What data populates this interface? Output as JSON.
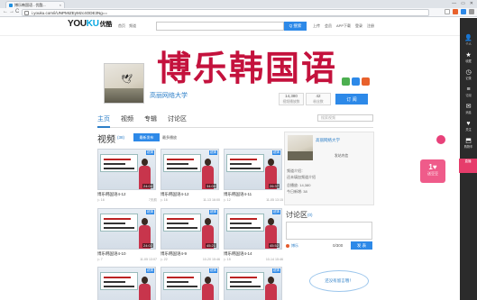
{
  "browser": {
    "tab_title": "博乐韩国语 - 优酷...",
    "url": "i.youku.com/i/UNPMIZEyMzc4ODE3Ng==",
    "back": "←",
    "forward": "→",
    "reload": "C",
    "win_min": "—",
    "win_max": "▭",
    "win_close": "✕"
  },
  "youku": {
    "logo_you": "YOU",
    "logo_ku": "KU",
    "logo_cn": "优酷",
    "top_links": [
      "首页",
      "频道"
    ],
    "search_button": "Q 搜索",
    "user_links": [
      "上传",
      "会员",
      "APP下载",
      "登录",
      "注册"
    ]
  },
  "channel": {
    "banner_title": "博乐韩国语",
    "name": "高丽网络大学",
    "stats": [
      {
        "value": "14,380",
        "label": "视频播放数"
      },
      {
        "value": "42",
        "label": "粉丝数"
      }
    ],
    "subscribe_label": "订 阅",
    "tabs": [
      "主页",
      "视频",
      "专辑",
      "讨论区"
    ],
    "search_placeholder": "搜索视频"
  },
  "videos": {
    "title": "视频",
    "count": "(38)",
    "sort_active": "最新发布",
    "sort_other": "最多播放",
    "items": [
      {
        "title": "博乐韩国语4-12",
        "plays": "16",
        "time": "7天前",
        "duration": "24:04"
      },
      {
        "title": "博乐韩国语4-12",
        "plays": "16",
        "time": "11-13 16:00",
        "duration": "34:00"
      },
      {
        "title": "博乐韩国语4-11",
        "plays": "12",
        "time": "11-05 13:15",
        "duration": "26:37"
      },
      {
        "title": "博乐韩国语4-10",
        "plays": "7",
        "time": "11-05 13:07",
        "duration": "24:02"
      },
      {
        "title": "博乐韩国语4-9",
        "plays": "22",
        "time": "10-20 15:46",
        "duration": "45:21"
      },
      {
        "title": "博乐韩国语4-14",
        "plays": "15",
        "time": "10-14 15:46",
        "duration": "45:52"
      },
      {
        "title": "",
        "plays": "",
        "time": "",
        "duration": "40:48"
      },
      {
        "title": "",
        "plays": "",
        "time": "",
        "duration": "34:39"
      },
      {
        "title": "",
        "plays": "",
        "time": "",
        "duration": "26:03"
      }
    ]
  },
  "side": {
    "name": "高丽网络大学",
    "contact": "发站内信",
    "info": [
      "频道介绍：",
      "还未填加频道介绍",
      "总播放: 14,380",
      "今日新增: 38"
    ]
  },
  "discussion": {
    "title": "讨论区",
    "count": "(0)",
    "user": "博乐",
    "counter": "0/300",
    "send": "发 表",
    "bubble": "还没有留言哦！"
  },
  "rsidebar": [
    {
      "icon": "👤",
      "label": "个人"
    },
    {
      "icon": "★",
      "label": "收藏"
    },
    {
      "icon": "◷",
      "label": "记录"
    },
    {
      "icon": "≡",
      "label": "订阅"
    },
    {
      "icon": "✉",
      "label": "消息"
    },
    {
      "icon": "♥",
      "label": "关注"
    },
    {
      "icon": "⬒",
      "label": "购物车"
    }
  ],
  "rsidebar_badge": "直播",
  "float_card": {
    "big": "1♥",
    "small": "送豆豆"
  },
  "colors": {
    "brand_blue": "#2d89e8",
    "banner_red": "#c4123d",
    "sidebar": "#2b2b2b"
  }
}
